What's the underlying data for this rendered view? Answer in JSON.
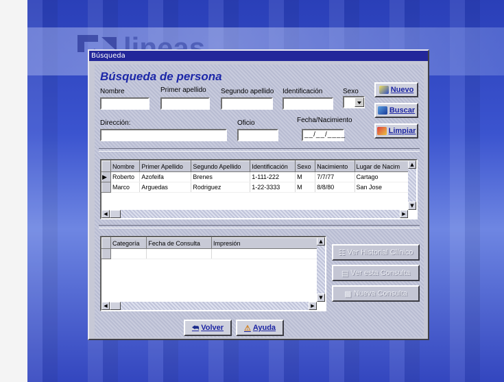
{
  "window": {
    "title": "Búsqueda"
  },
  "desktop": {
    "logo_text": "lineas"
  },
  "form": {
    "heading": "Búsqueda de persona",
    "labels": {
      "nombre": "Nombre",
      "primer_apellido": "Primer apellido",
      "segundo_apellido": "Segundo apellido",
      "identificacion": "Identificación",
      "sexo": "Sexo",
      "direccion": "Dirección:",
      "oficio": "Oficio",
      "fecha_nacimiento": "Fecha/Nacimiento"
    },
    "values": {
      "nombre": "",
      "primer_apellido": "",
      "segundo_apellido": "",
      "identificacion": "",
      "sexo": "",
      "direccion": "",
      "oficio": "",
      "fecha_nacimiento": "__/__/____"
    }
  },
  "buttons": {
    "nuevo": "Nuevo",
    "buscar": "Buscar",
    "limpiar": "Limpiar",
    "ver_historial": "Ver Historial Clínico",
    "ver_consulta": "Ver esta Consulta",
    "nueva_consulta": "Nueva Consulta",
    "volver": "Volver",
    "ayuda": "Ayuda"
  },
  "persons_table": {
    "columns": [
      "Nombre",
      "Primer Apellido",
      "Segundo Apellido",
      "Identificación",
      "Sexo",
      "Nacimiento",
      "Lugar de Nacim"
    ],
    "rows": [
      [
        "Roberto",
        "Azofeifa",
        "Brenes",
        "1-111-222",
        "M",
        "7/7/77",
        "Cartago"
      ],
      [
        "Marco",
        "Arguedas",
        "Rodriguez",
        "1-22-3333",
        "M",
        "8/8/80",
        "San Jose"
      ]
    ]
  },
  "consult_table": {
    "columns": [
      "Categoría",
      "Fecha de Consulta",
      "Impresión"
    ]
  },
  "colors": {
    "accent": "#1c27a8",
    "titlebar": "#23279a"
  }
}
